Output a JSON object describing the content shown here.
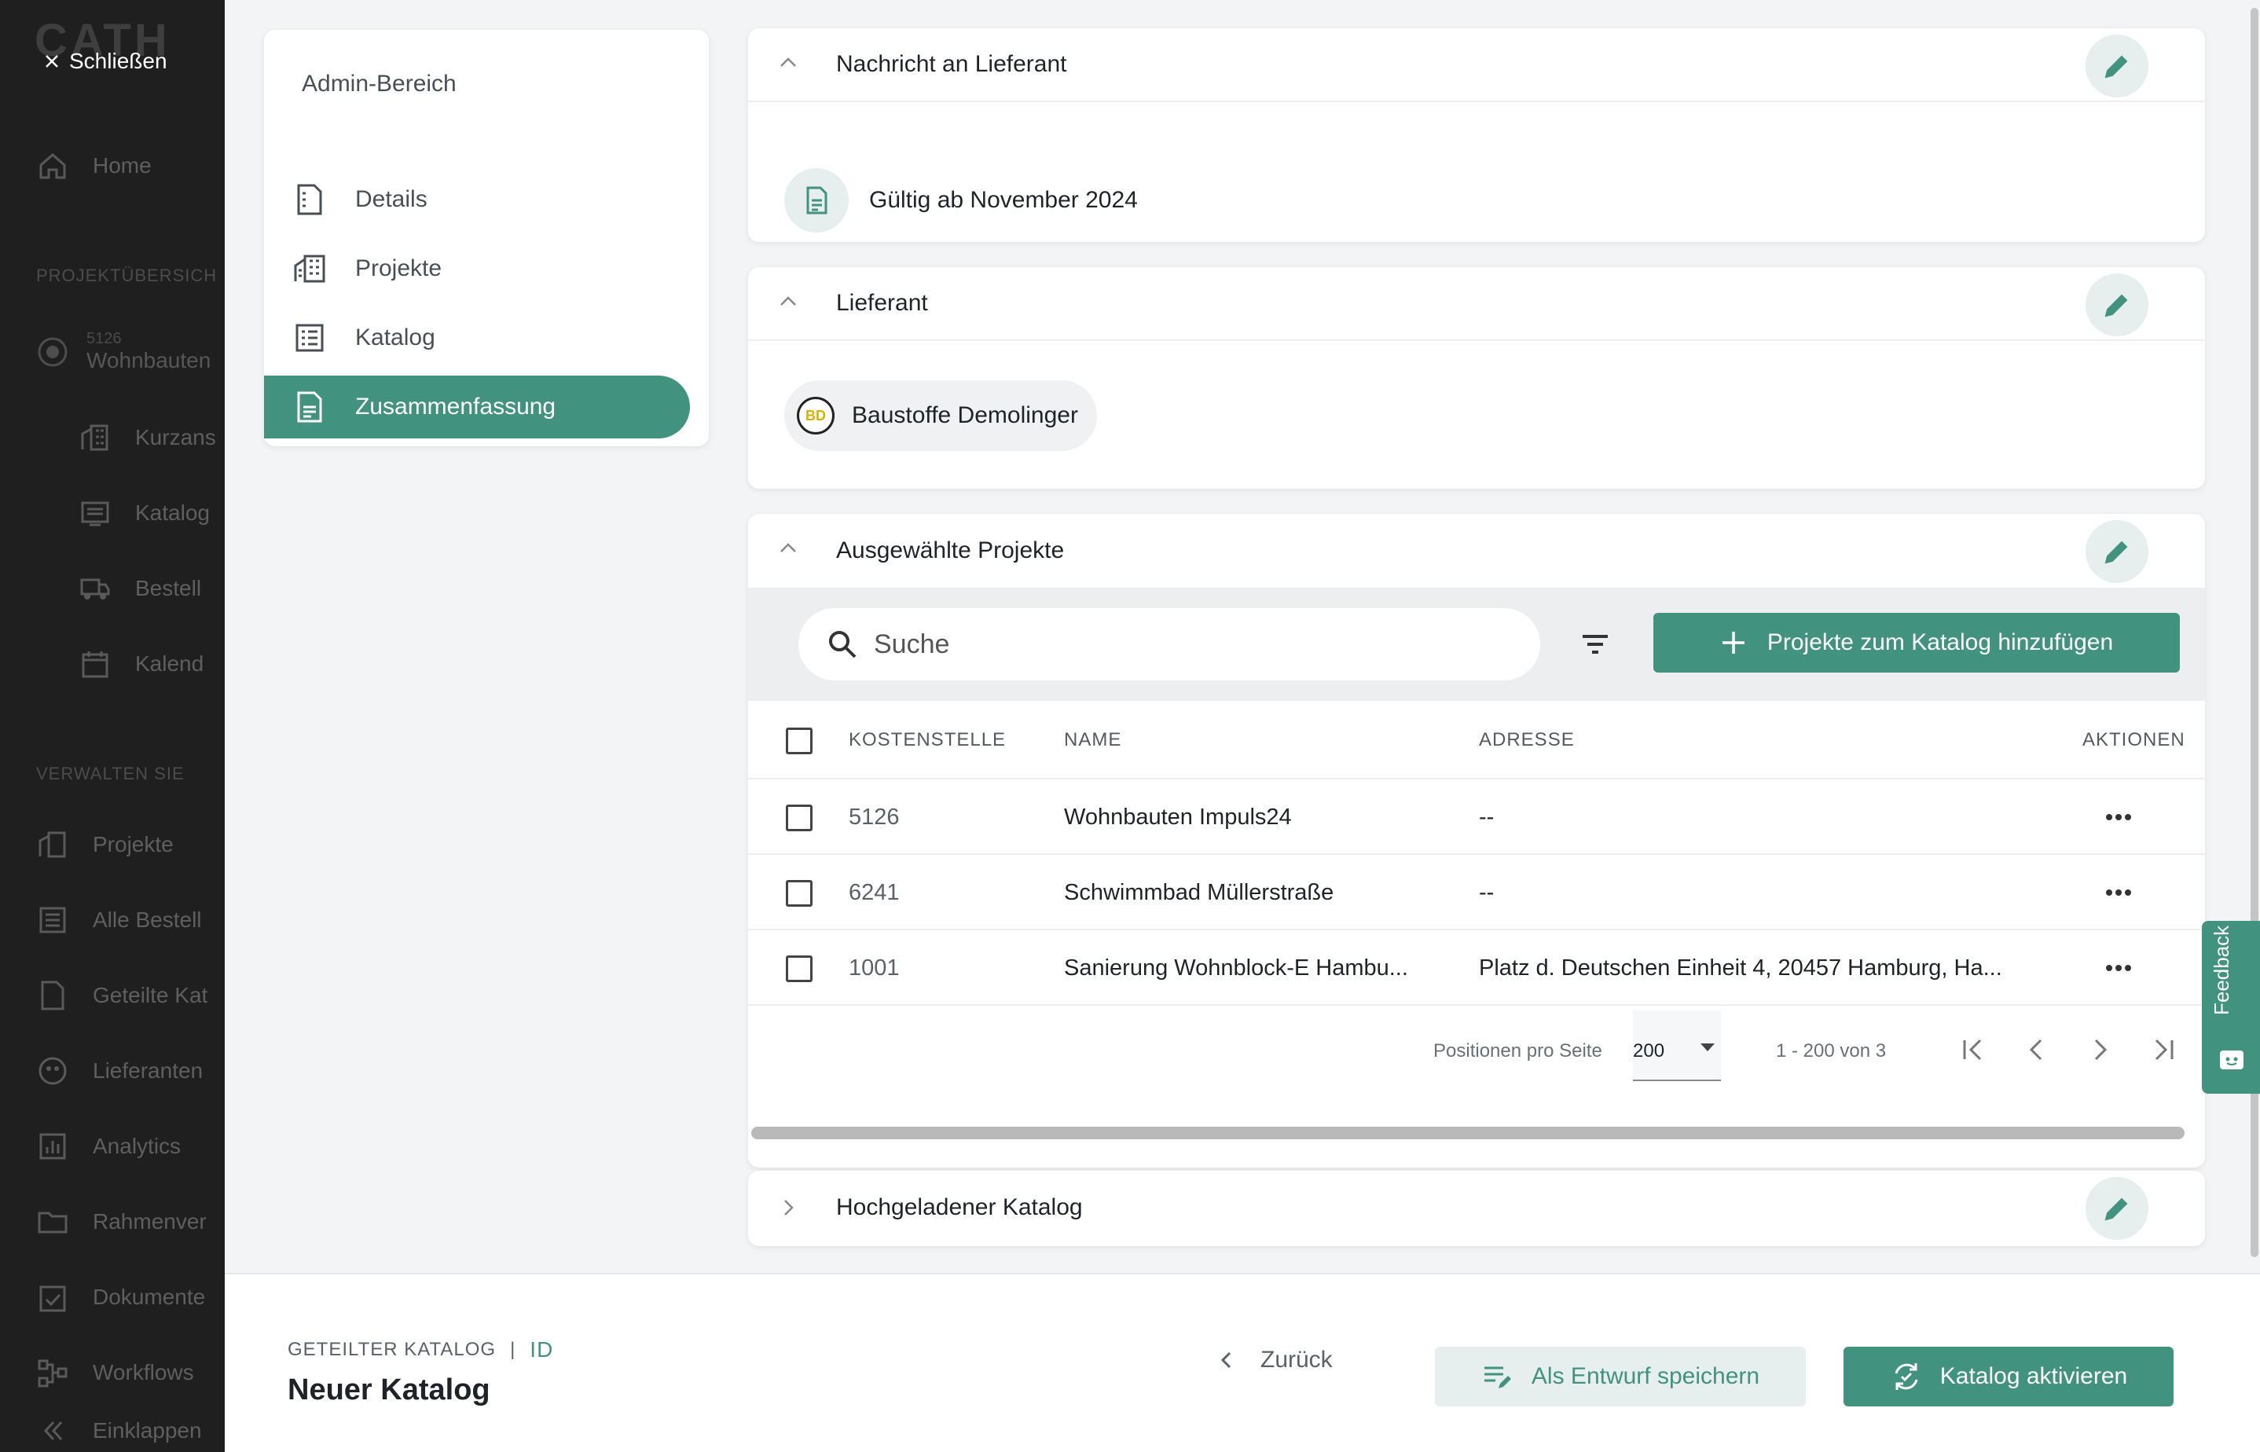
{
  "colors": {
    "accent": "#41927f",
    "accent_light": "#e6efed",
    "nav_bg": "#1f1f1f"
  },
  "nav": {
    "logo": "CATH",
    "close_label": "Schließen",
    "items_top": [
      {
        "label": "Home",
        "icon": "home-icon"
      }
    ],
    "section1": "PROJEKTÜBERSICH",
    "project": {
      "number": "5126",
      "name": "Wohnbauten"
    },
    "project_items": [
      {
        "label": "Kurzans",
        "icon": "building-icon"
      },
      {
        "label": "Katalog",
        "icon": "catalog-icon"
      },
      {
        "label": "Bestell",
        "icon": "truck-icon"
      },
      {
        "label": "Kalend",
        "icon": "calendar-icon"
      }
    ],
    "section2": "VERWALTEN SIE",
    "manage_items": [
      {
        "label": "Projekte",
        "icon": "building-icon"
      },
      {
        "label": "Alle Bestell",
        "icon": "orders-icon"
      },
      {
        "label": "Geteilte Kat",
        "icon": "shared-catalog-icon"
      },
      {
        "label": "Lieferanten",
        "icon": "supplier-icon"
      },
      {
        "label": "Analytics",
        "icon": "analytics-icon"
      },
      {
        "label": "Rahmenver",
        "icon": "folder-star-icon"
      },
      {
        "label": "Dokumente",
        "icon": "document-check-icon"
      },
      {
        "label": "Workflows",
        "icon": "workflow-icon"
      },
      {
        "label": "Einklappen",
        "icon": "collapse-icon"
      }
    ]
  },
  "steps": {
    "header": "Admin-Bereich",
    "items": [
      {
        "label": "Details",
        "icon": "document-icon"
      },
      {
        "label": "Projekte",
        "icon": "building-icon"
      },
      {
        "label": "Katalog",
        "icon": "list-icon"
      },
      {
        "label": "Zusammenfassung",
        "icon": "summary-icon"
      }
    ],
    "active": "Zusammenfassung"
  },
  "sections": {
    "message": {
      "title": "Nachricht an Lieferant",
      "text": "Gültig ab November 2024"
    },
    "supplier": {
      "title": "Lieferant",
      "name": "Baustoffe Demolinger",
      "logo_text": "BD"
    },
    "projects": {
      "title": "Ausgewählte Projekte",
      "search_placeholder": "Suche",
      "add_button": "Projekte zum Katalog hinzufügen",
      "columns": [
        "KOSTENSTELLE",
        "NAME",
        "ADRESSE",
        "AKTIONEN"
      ],
      "rows": [
        {
          "cost_center": "5126",
          "name": "Wohnbauten Impuls24",
          "address": "--"
        },
        {
          "cost_center": "6241",
          "name": "Schwimmbad Müllerstraße",
          "address": "--"
        },
        {
          "cost_center": "1001",
          "name": "Sanierung Wohnblock-E Hambu...",
          "address": "Platz d. Deutschen Einheit 4, 20457 Hamburg, Ha..."
        }
      ],
      "pager": {
        "per_page_label": "Positionen pro Seite",
        "per_page": "200",
        "range": "1 - 200 von 3"
      }
    },
    "upload": {
      "title": "Hochgeladener Katalog"
    }
  },
  "feedback": "Feedback",
  "footer": {
    "crumb_a": "GETEILTER KATALOG",
    "crumb_sep": "|",
    "crumb_b": "ID",
    "title": "Neuer Katalog",
    "back": "Zurück",
    "draft": "Als Entwurf speichern",
    "activate": "Katalog aktivieren"
  }
}
